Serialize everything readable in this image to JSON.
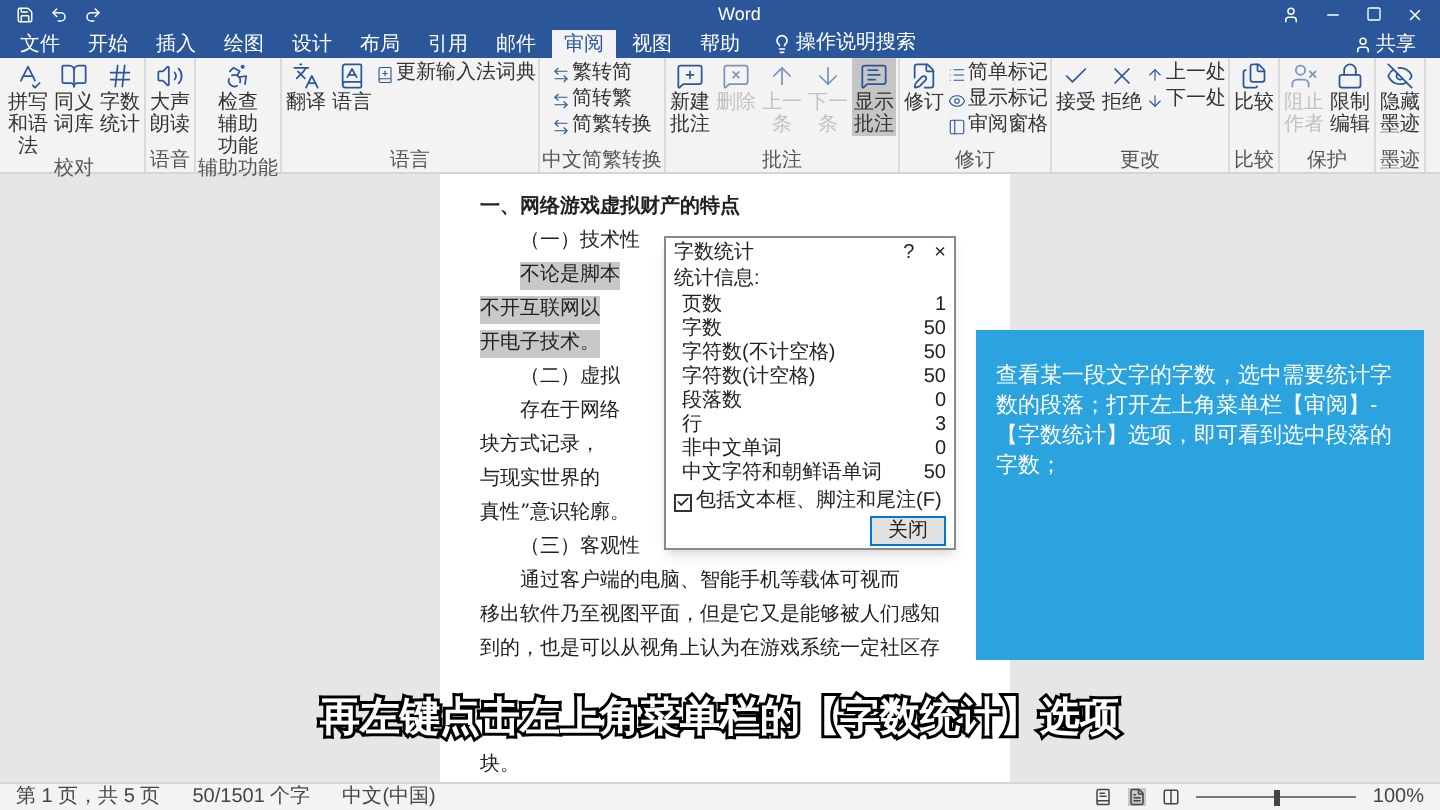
{
  "window": {
    "title": "Word"
  },
  "tabs": [
    {
      "label": "文件",
      "selected": false
    },
    {
      "label": "开始",
      "selected": false
    },
    {
      "label": "插入",
      "selected": false
    },
    {
      "label": "绘图",
      "selected": false
    },
    {
      "label": "设计",
      "selected": false
    },
    {
      "label": "布局",
      "selected": false
    },
    {
      "label": "引用",
      "selected": false
    },
    {
      "label": "邮件",
      "selected": false
    },
    {
      "label": "审阅",
      "selected": true
    },
    {
      "label": "视图",
      "selected": false
    },
    {
      "label": "帮助",
      "selected": false
    }
  ],
  "tell_me": {
    "placeholder": "操作说明搜索"
  },
  "share": "共享",
  "ribbon": {
    "groups": [
      {
        "label": "校对",
        "buttons": [
          {
            "label": "拼写和语法",
            "kind": "large",
            "on": false,
            "disabled": false
          },
          {
            "label": "同义词库",
            "kind": "large",
            "on": false,
            "disabled": false
          },
          {
            "label": "字数统计",
            "kind": "large",
            "on": false,
            "disabled": false
          }
        ]
      },
      {
        "label": "语音",
        "buttons": [
          {
            "label": "大声朗读",
            "kind": "large",
            "on": false,
            "disabled": false
          }
        ]
      },
      {
        "label": "辅助功能",
        "buttons": [
          {
            "label": "检查辅助功能",
            "kind": "large",
            "on": false,
            "disabled": false
          }
        ]
      },
      {
        "label": "语言",
        "buttons": [
          {
            "label": "翻译",
            "kind": "large",
            "on": false,
            "disabled": false
          },
          {
            "label": "语言",
            "kind": "large",
            "on": false,
            "disabled": false
          },
          {
            "label": "更新输入法词典",
            "kind": "small",
            "on": false,
            "disabled": false
          }
        ]
      },
      {
        "label": "中文简繁转换",
        "buttons": [
          {
            "label": "繁转简",
            "kind": "small",
            "on": false,
            "disabled": false
          },
          {
            "label": "简转繁",
            "kind": "small",
            "on": false,
            "disabled": false
          },
          {
            "label": "简繁转换",
            "kind": "small",
            "on": false,
            "disabled": false
          }
        ]
      },
      {
        "label": "批注",
        "buttons": [
          {
            "label": "新建批注",
            "kind": "large",
            "on": false,
            "disabled": false
          },
          {
            "label": "删除",
            "kind": "large",
            "on": false,
            "disabled": true
          },
          {
            "label": "上一条",
            "kind": "large",
            "on": false,
            "disabled": true
          },
          {
            "label": "下一条",
            "kind": "large",
            "on": false,
            "disabled": true
          },
          {
            "label": "显示批注",
            "kind": "large",
            "on": true,
            "disabled": false
          }
        ]
      },
      {
        "label": "修订",
        "buttons": [
          {
            "label": "修订",
            "kind": "large",
            "on": false,
            "disabled": false
          },
          {
            "label": "简单标记",
            "kind": "small",
            "on": false,
            "disabled": false
          },
          {
            "label": "显示标记",
            "kind": "small",
            "on": false,
            "disabled": false
          },
          {
            "label": "审阅窗格",
            "kind": "small",
            "on": false,
            "disabled": false
          }
        ]
      },
      {
        "label": "更改",
        "buttons": [
          {
            "label": "接受",
            "kind": "large",
            "on": false,
            "disabled": false
          },
          {
            "label": "拒绝",
            "kind": "large",
            "on": false,
            "disabled": false
          },
          {
            "label": "上一处",
            "kind": "small",
            "on": false,
            "disabled": false
          },
          {
            "label": "下一处",
            "kind": "small",
            "on": false,
            "disabled": false
          }
        ]
      },
      {
        "label": "比较",
        "buttons": [
          {
            "label": "比较",
            "kind": "large",
            "on": false,
            "disabled": false
          }
        ]
      },
      {
        "label": "保护",
        "buttons": [
          {
            "label": "阻止作者",
            "kind": "large",
            "on": false,
            "disabled": true
          },
          {
            "label": "限制编辑",
            "kind": "large",
            "on": false,
            "disabled": false
          }
        ]
      },
      {
        "label": "墨迹",
        "buttons": [
          {
            "label": "隐藏墨迹",
            "kind": "large",
            "on": false,
            "disabled": false
          }
        ]
      }
    ]
  },
  "document": {
    "lines": [
      {
        "text": "一、网络游戏虚拟财产的特点",
        "kind": "heading",
        "selected": false
      },
      {
        "text": "（一）技术性",
        "kind": "indent",
        "selected": false
      },
      {
        "text": "不论是脚本",
        "kind": "indent",
        "selected": true
      },
      {
        "text": "不开互联网以",
        "kind": "plain",
        "selected": true
      },
      {
        "text": "开电子技术。",
        "kind": "plain",
        "selected": true
      },
      {
        "text": "（二）虚拟",
        "kind": "indent",
        "selected": false
      },
      {
        "text": "存在于网络",
        "kind": "indent",
        "selected": false
      },
      {
        "text": "块方式记录，",
        "kind": "plain",
        "selected": false
      },
      {
        "text": "与现实世界的",
        "kind": "plain",
        "selected": false
      },
      {
        "text": "真性”意识轮廓。",
        "kind": "plain",
        "selected": false
      },
      {
        "text": "（三）客观性",
        "kind": "indent",
        "selected": false
      },
      {
        "text": "通过客户端的电脑、智能手机等载体可视而",
        "kind": "indent",
        "selected": false
      },
      {
        "text": "移出软件乃至视图平面，但是它又是能够被人们感知",
        "kind": "plain",
        "selected": false
      },
      {
        "text": "到的，也是可以从视角上认为在游戏系统一定社区存",
        "kind": "plain",
        "selected": false
      }
    ],
    "tail_lines": [
      {
        "text": "块。",
        "kind": "plain",
        "selected": false
      }
    ]
  },
  "dialog": {
    "title": "字数统计",
    "help": "?",
    "close": "×",
    "section": "统计信息:",
    "stats": [
      {
        "label": "页数",
        "value": "1"
      },
      {
        "label": "字数",
        "value": "50"
      },
      {
        "label": "字符数(不计空格)",
        "value": "50"
      },
      {
        "label": "字符数(计空格)",
        "value": "50"
      },
      {
        "label": "段落数",
        "value": "0"
      },
      {
        "label": "行",
        "value": "3"
      },
      {
        "label": "非中文单词",
        "value": "0"
      },
      {
        "label": "中文字符和朝鲜语单词",
        "value": "50"
      }
    ],
    "checkbox": {
      "label": "包括文本框、脚注和尾注(F)",
      "checked": true
    },
    "button": "关闭"
  },
  "instruction_card": {
    "text": "查看某一段文字的字数，选中需要统计字数的段落；打开左上角菜单栏【审阅】-【字数统计】选项，即可看到选中段落的字数；"
  },
  "caption": "再左键点击左上角菜单栏的【字数统计】选项",
  "status_bar": {
    "page": "第 1 页，共 5 页",
    "words": "50/1501 个字",
    "language": "中文(中国)",
    "zoom": "100%",
    "zoom_slider": {
      "level": 0.5
    }
  }
}
